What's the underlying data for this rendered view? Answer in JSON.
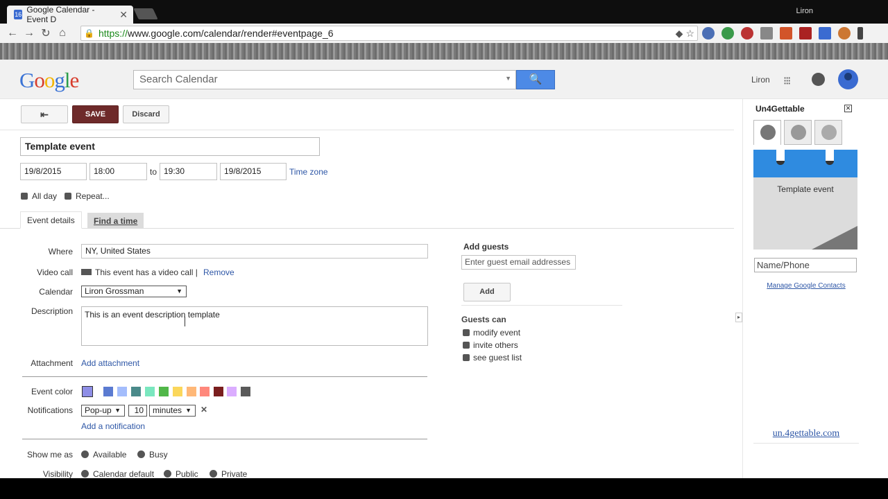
{
  "browser": {
    "tab_title": "Google Calendar - Event D",
    "tab_favicon": "16",
    "tab_close": "✕",
    "profile": "Liron",
    "url_https": "https://",
    "url_rest": "www.google.com/calendar/render#eventpage_6"
  },
  "header": {
    "logo_letters": [
      "G",
      "o",
      "o",
      "g",
      "l",
      "e"
    ],
    "search_placeholder": "Search Calendar",
    "user_name": "Liron"
  },
  "actions": {
    "back": "⇤",
    "save": "SAVE",
    "discard": "Discard"
  },
  "event": {
    "title": "Template event",
    "start_date": "19/8/2015",
    "start_time": "18:00",
    "to": "to",
    "end_time": "19:30",
    "end_date": "19/8/2015",
    "time_zone": "Time zone",
    "all_day": "All day",
    "repeat": "Repeat..."
  },
  "tabs": {
    "details": "Event details",
    "find_time": "Find a time"
  },
  "details": {
    "where_label": "Where",
    "where_value": "NY, United States",
    "video_label": "Video call",
    "video_text": "This event has a video call |",
    "video_remove": "Remove",
    "calendar_label": "Calendar",
    "calendar_value": "Liron Grossman",
    "description_label": "Description",
    "description_value": "This is an event description template",
    "attachment_label": "Attachment",
    "attachment_link": "Add attachment",
    "color_label": "Event color",
    "notifications_label": "Notifications",
    "notif_type": "Pop-up",
    "notif_value": "10",
    "notif_unit": "minutes",
    "notif_remove": "✕",
    "add_notification": "Add a notification",
    "show_me_as_label": "Show me as",
    "show_available": "Available",
    "show_busy": "Busy",
    "visibility_label": "Visibility",
    "vis_default": "Calendar default",
    "vis_public": "Public",
    "vis_private": "Private"
  },
  "event_colors": [
    "#8e8ee6",
    "#5b7bd1",
    "#a4bdfc",
    "#4a8a8a",
    "#7ae7bf",
    "#51b749",
    "#fbd75b",
    "#ffb878",
    "#ff887c",
    "#7a1e1e",
    "#dbadff",
    "#5a5a5a"
  ],
  "guests": {
    "add_guests_label": "Add guests",
    "input_placeholder": "Enter guest email addresses",
    "add_button": "Add",
    "can_label": "Guests can",
    "options": [
      "modify event",
      "invite others",
      "see guest list"
    ]
  },
  "sidebar": {
    "title": "Un4Gettable",
    "close": "✕",
    "note_text": "Template event",
    "name_placeholder": "Name/Phone",
    "manage_contacts": "Manage Google Contacts",
    "site_link": "un.4gettable.com",
    "expander": "▸"
  }
}
